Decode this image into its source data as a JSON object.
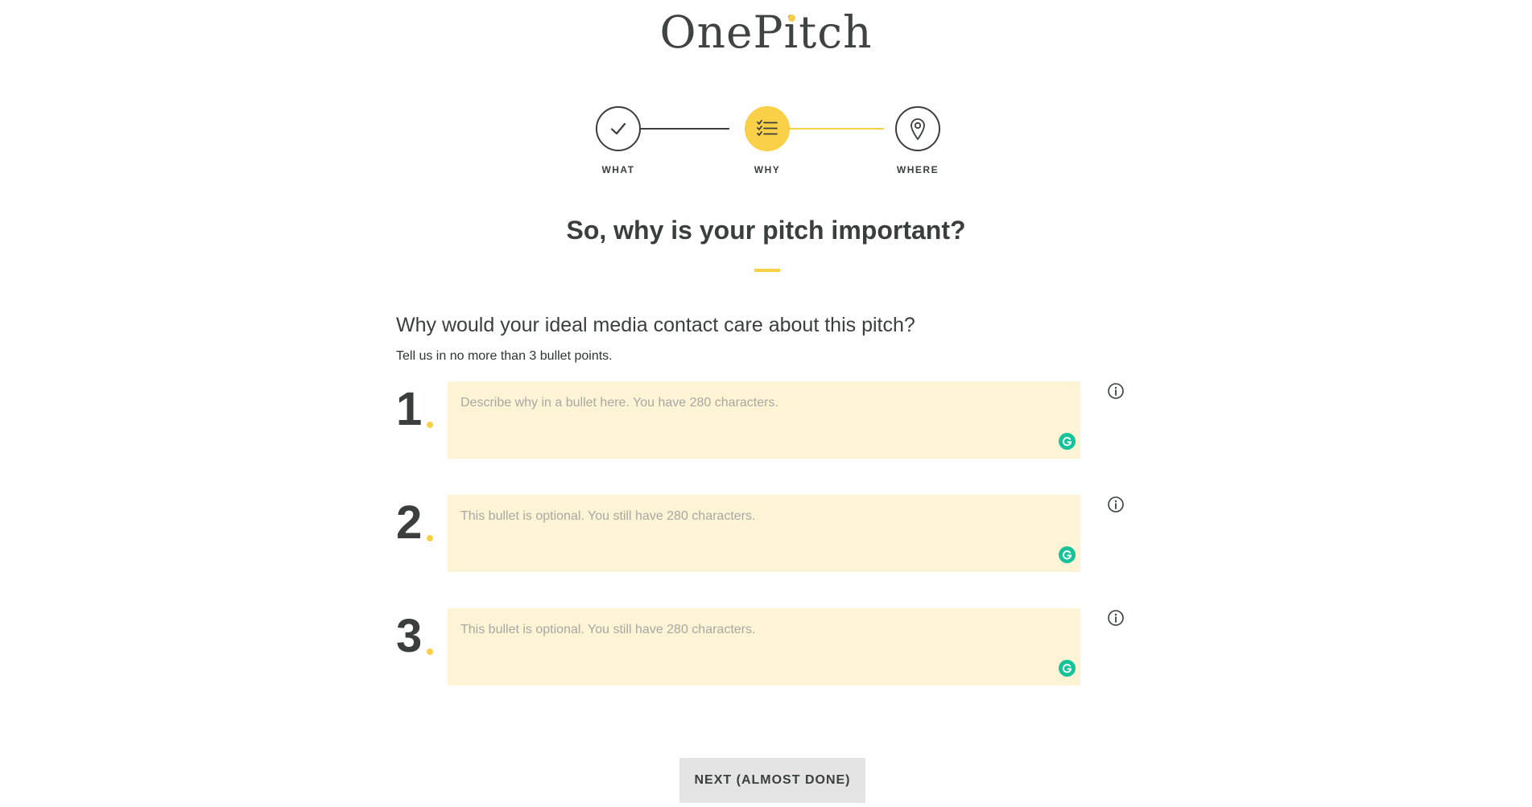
{
  "logo": {
    "text_before_i": "OneP",
    "i": "i",
    "text_after_i": "tch"
  },
  "colors": {
    "accent": "#f9d048",
    "field_bg": "#fdf4d6",
    "text": "#3a3f3d",
    "grammarly": "#15c39a",
    "button_bg": "#e4e4e4"
  },
  "stepper": {
    "steps": [
      {
        "label": "WHAT",
        "icon": "check-icon",
        "state": "complete"
      },
      {
        "label": "WHY",
        "icon": "checklist-icon",
        "state": "active"
      },
      {
        "label": "WHERE",
        "icon": "map-pin-icon",
        "state": "upcoming"
      }
    ]
  },
  "main": {
    "heading": "So, why is your pitch important?",
    "question": "Why would your ideal media contact care about this pitch?",
    "hint": "Tell us in no more than 3 bullet points."
  },
  "bullets": [
    {
      "number": "1",
      "placeholder": "Describe why in a bullet here. You have 280 characters.",
      "value": ""
    },
    {
      "number": "2",
      "placeholder": "This bullet is optional. You still have 280 characters.",
      "value": ""
    },
    {
      "number": "3",
      "placeholder": "This bullet is optional. You still have 280 characters.",
      "value": ""
    }
  ],
  "actions": {
    "next_label": "NEXT (ALMOST DONE)"
  }
}
